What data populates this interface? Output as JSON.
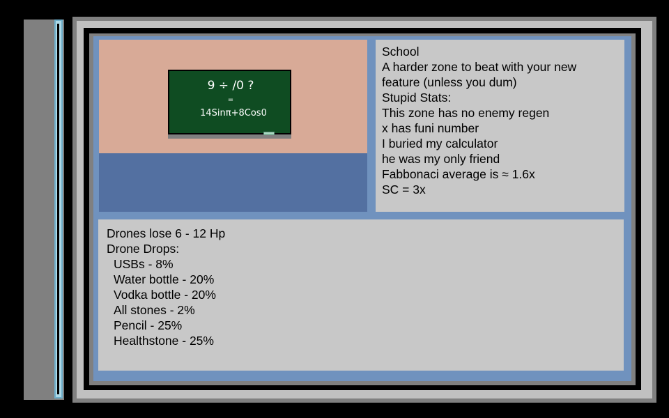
{
  "zone": {
    "image": {
      "icon": "chalkboard-illustration",
      "board_line1": "9 ÷ /0 ?",
      "board_line2": "=",
      "board_line3": "14Sinπ+8Cos0"
    },
    "description": {
      "title": "School",
      "text_line1": "A harder zone to beat with your new",
      "text_line2": "feature (unless you dum)",
      "stats_heading": "Stupid Stats:",
      "stats": [
        "This zone has no enemy regen",
        "x has funi number",
        "I buried my calculator",
        "he was my only friend",
        "Fabbonaci average is ≈ 1.6x",
        "SC = 3x"
      ]
    },
    "info": {
      "hp_loss": "Drones lose 6 - 12 Hp",
      "drops_heading": "Drone Drops:",
      "drops": [
        "USBs - 8%",
        "Water bottle - 20%",
        "Vodka bottle - 20%",
        "All stones - 2%",
        "Pencil - 25%",
        "Healthstone - 25%"
      ]
    }
  },
  "colors": {
    "background": "#000000",
    "panel_gray": "#C8C8C8",
    "frame_blue": "#7092BE",
    "wall": "#D8AA97",
    "floor": "#5370A1",
    "chalkboard": "#0F4C22",
    "sidebar_strip": "#ADD8E6"
  }
}
